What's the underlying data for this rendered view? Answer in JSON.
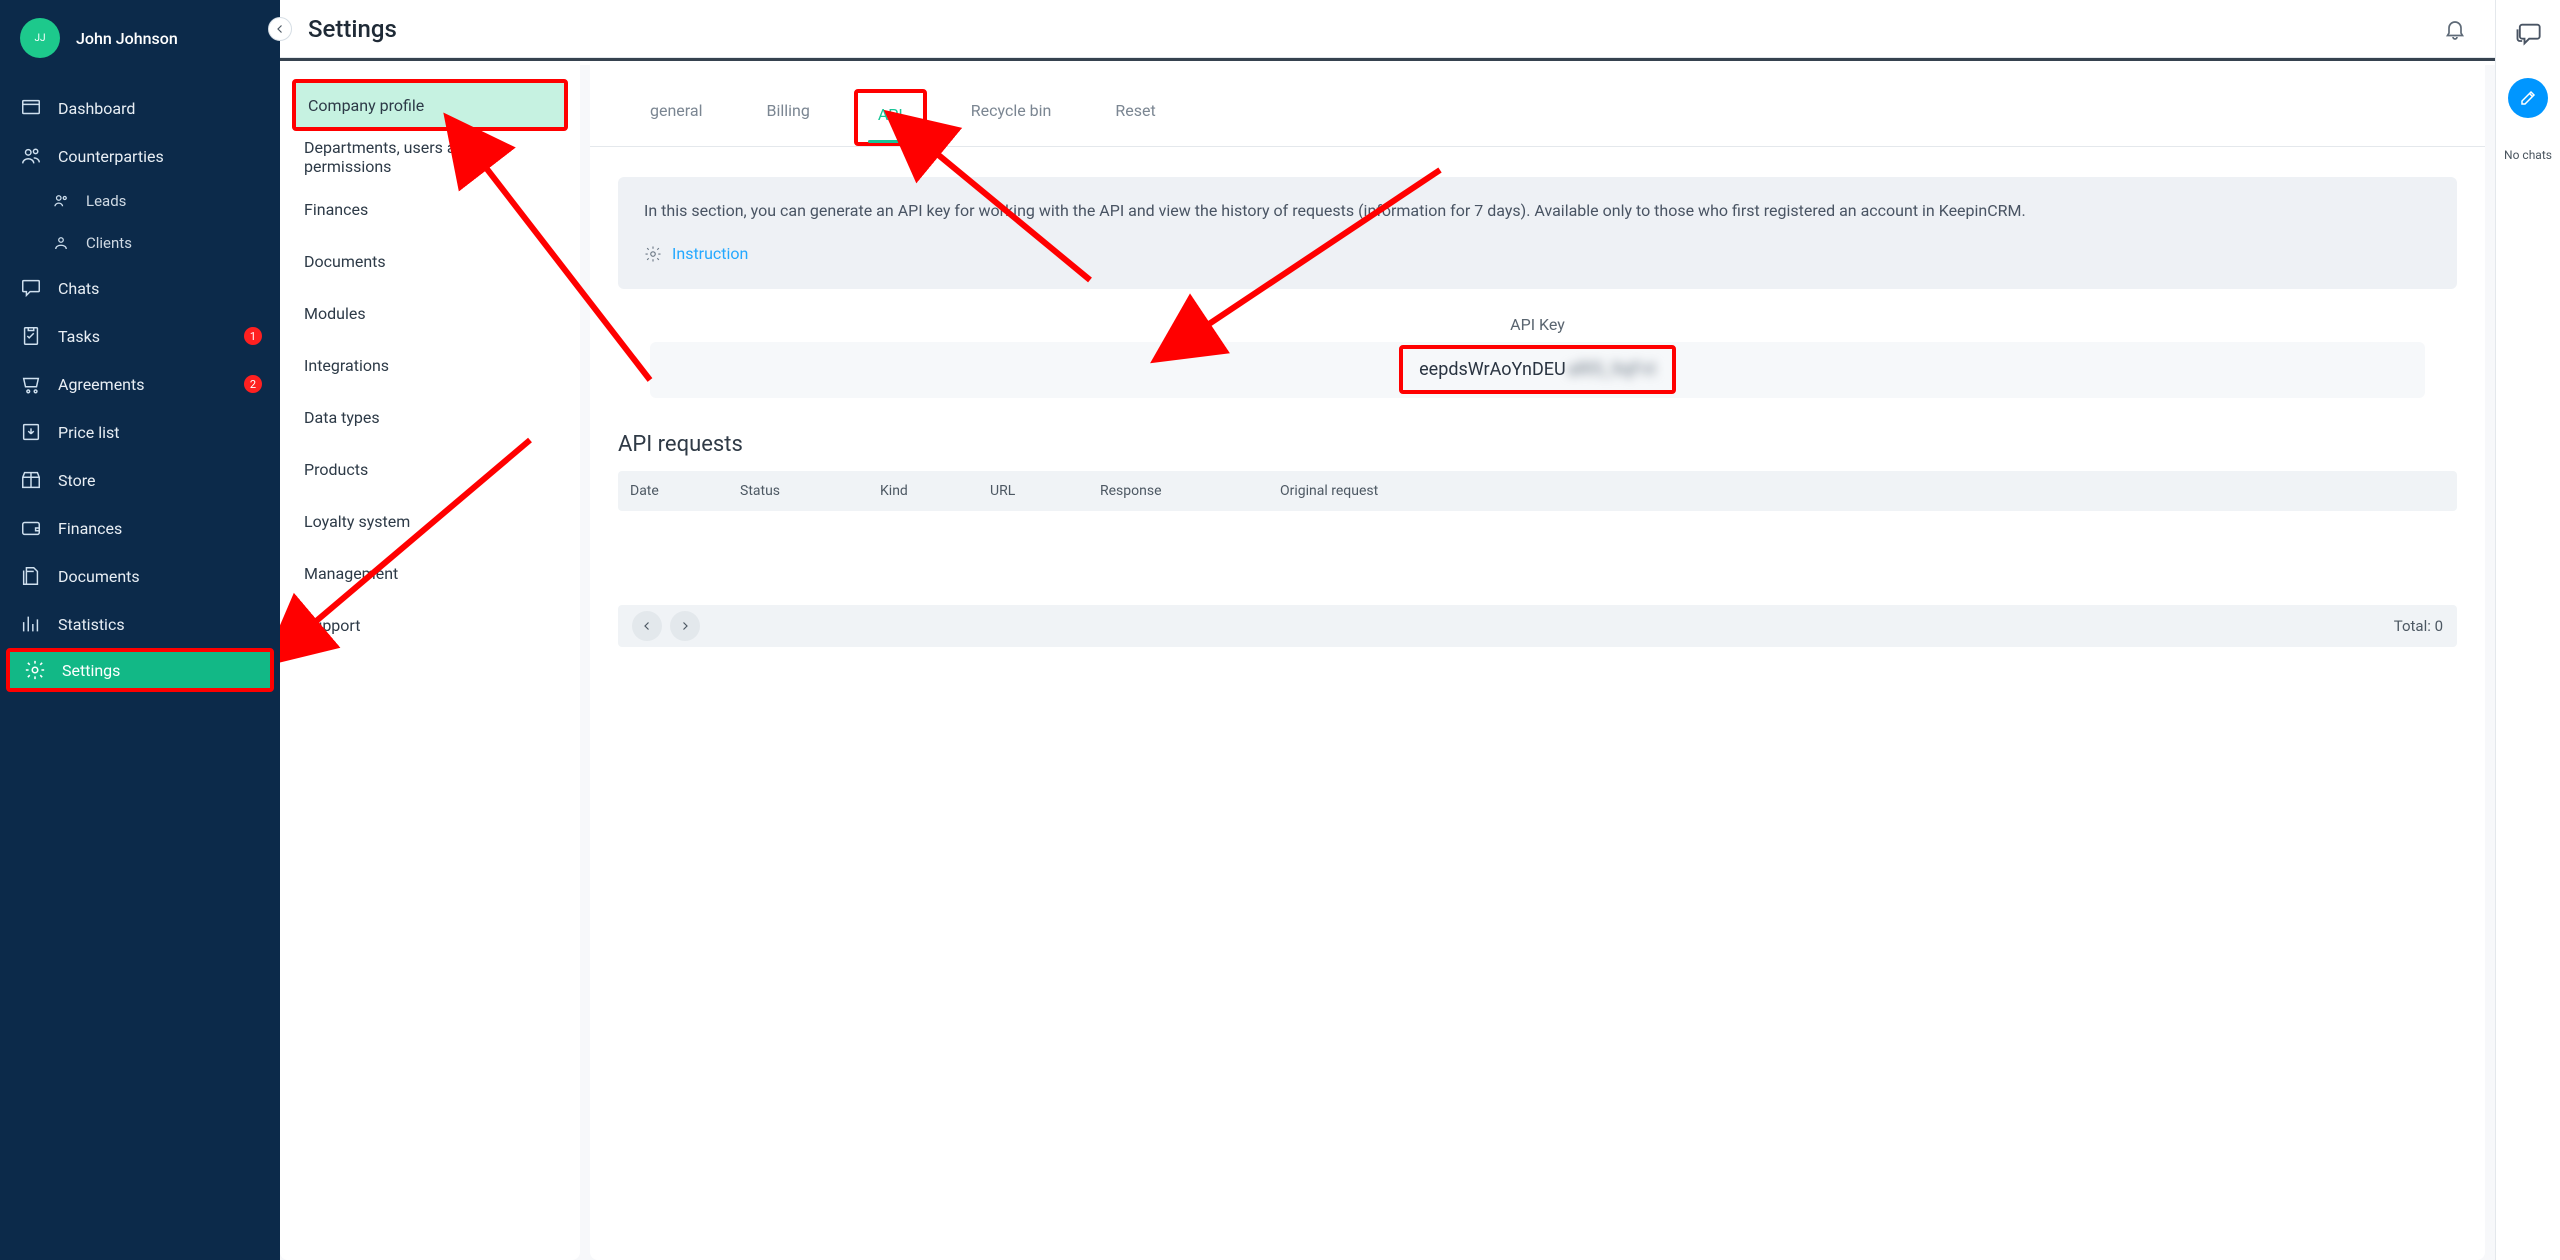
{
  "user": {
    "initials": "JJ",
    "name": "John Johnson"
  },
  "sidebar": {
    "items": [
      {
        "label": "Dashboard"
      },
      {
        "label": "Counterparties"
      },
      {
        "label": "Leads"
      },
      {
        "label": "Clients"
      },
      {
        "label": "Chats"
      },
      {
        "label": "Tasks",
        "badge": "1"
      },
      {
        "label": "Agreements",
        "badge": "2"
      },
      {
        "label": "Price list"
      },
      {
        "label": "Store"
      },
      {
        "label": "Finances"
      },
      {
        "label": "Documents"
      },
      {
        "label": "Statistics"
      },
      {
        "label": "Settings"
      }
    ]
  },
  "header": {
    "title": "Settings"
  },
  "settings_nav": {
    "items": [
      "Company profile",
      "Departments, users and permissions",
      "Finances",
      "Documents",
      "Modules",
      "Integrations",
      "Data types",
      "Products",
      "Loyalty system",
      "Management",
      "Support"
    ]
  },
  "tabs": {
    "items": [
      "general",
      "Billing",
      "API",
      "Recycle bin",
      "Reset"
    ],
    "active_index": 2
  },
  "api": {
    "info_text": "In this section, you can generate an API key for working with the API and view the history of requests (information for 7 days). Available only to those who first registered an account in KeepinCRM.",
    "instruction_label": "Instruction",
    "key_label": "API Key",
    "key_visible": "eepdsWrAoYnDEU",
    "key_hidden": "aRl5_9qFvt",
    "requests_title": "API requests",
    "columns": [
      "Date",
      "Status",
      "Kind",
      "URL",
      "Response",
      "Original request"
    ],
    "total_label": "Total: 0"
  },
  "right_rail": {
    "no_chats": "No chats"
  }
}
